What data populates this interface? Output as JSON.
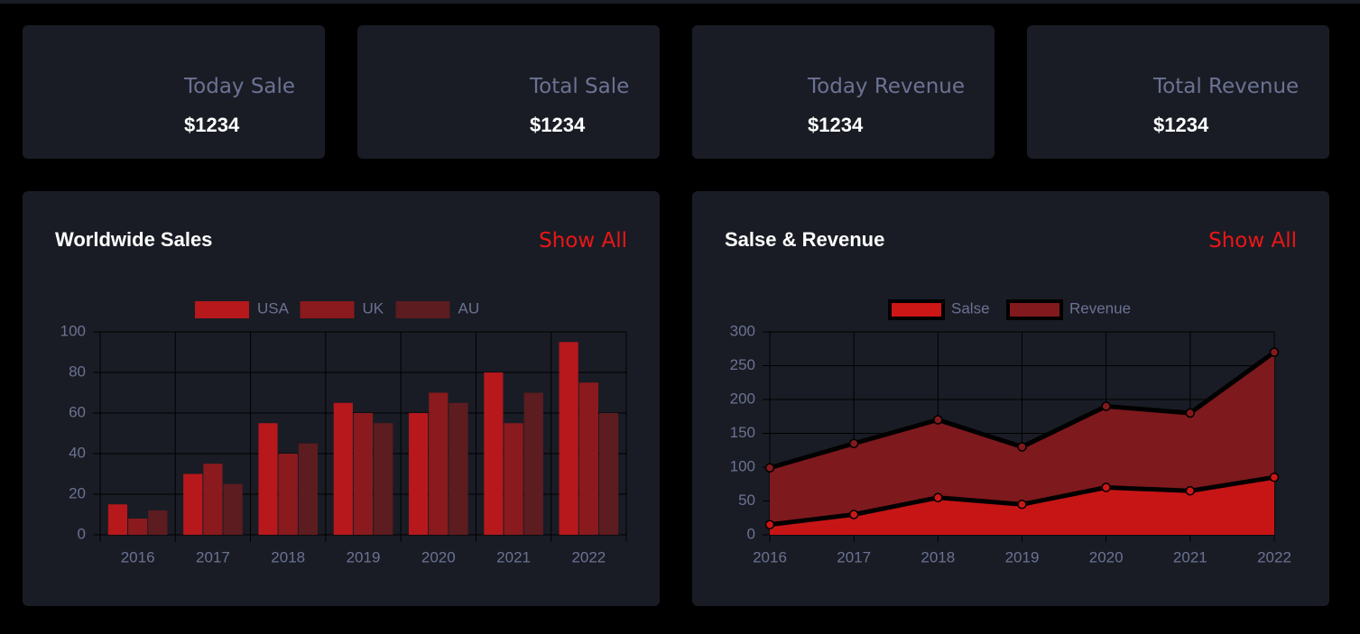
{
  "stats": [
    {
      "label": "Today Sale",
      "value": "$1234"
    },
    {
      "label": "Total Sale",
      "value": "$1234"
    },
    {
      "label": "Today Revenue",
      "value": "$1234"
    },
    {
      "label": "Total Revenue",
      "value": "$1234"
    }
  ],
  "worldwide": {
    "title": "Worldwide Sales",
    "link": "Show All"
  },
  "salesRevenue": {
    "title": "Salse & Revenue",
    "link": "Show All"
  },
  "colors": {
    "card": "#191c24",
    "accent": "#eb1616",
    "muted": "#6c7293",
    "usa": "#b6181c",
    "uk": "#8a1a1d",
    "au": "#5c1c20",
    "salse_fill": "#cd1616",
    "revenue_fill": "#821a1d"
  },
  "chart_data": [
    {
      "type": "bar",
      "categories": [
        "2016",
        "2017",
        "2018",
        "2019",
        "2020",
        "2021",
        "2022"
      ],
      "series": [
        {
          "name": "USA",
          "values": [
            15,
            30,
            55,
            65,
            60,
            80,
            95
          ]
        },
        {
          "name": "UK",
          "values": [
            8,
            35,
            40,
            60,
            70,
            55,
            75
          ]
        },
        {
          "name": "AU",
          "values": [
            12,
            25,
            45,
            55,
            65,
            70,
            60
          ]
        }
      ],
      "ylim": [
        0,
        100
      ],
      "yticks": [
        0,
        20,
        40,
        60,
        80,
        100
      ],
      "grid": true,
      "legend": "top-center"
    },
    {
      "type": "area",
      "x": [
        "2016",
        "2017",
        "2018",
        "2019",
        "2020",
        "2021",
        "2022"
      ],
      "series": [
        {
          "name": "Salse",
          "values": [
            15,
            30,
            55,
            45,
            70,
            65,
            85
          ]
        },
        {
          "name": "Revenue",
          "values": [
            99,
            135,
            170,
            130,
            190,
            180,
            270
          ]
        }
      ],
      "ylim": [
        0,
        300
      ],
      "yticks": [
        0,
        50,
        100,
        150,
        200,
        250,
        300
      ],
      "grid": true,
      "legend": "top-center"
    }
  ]
}
